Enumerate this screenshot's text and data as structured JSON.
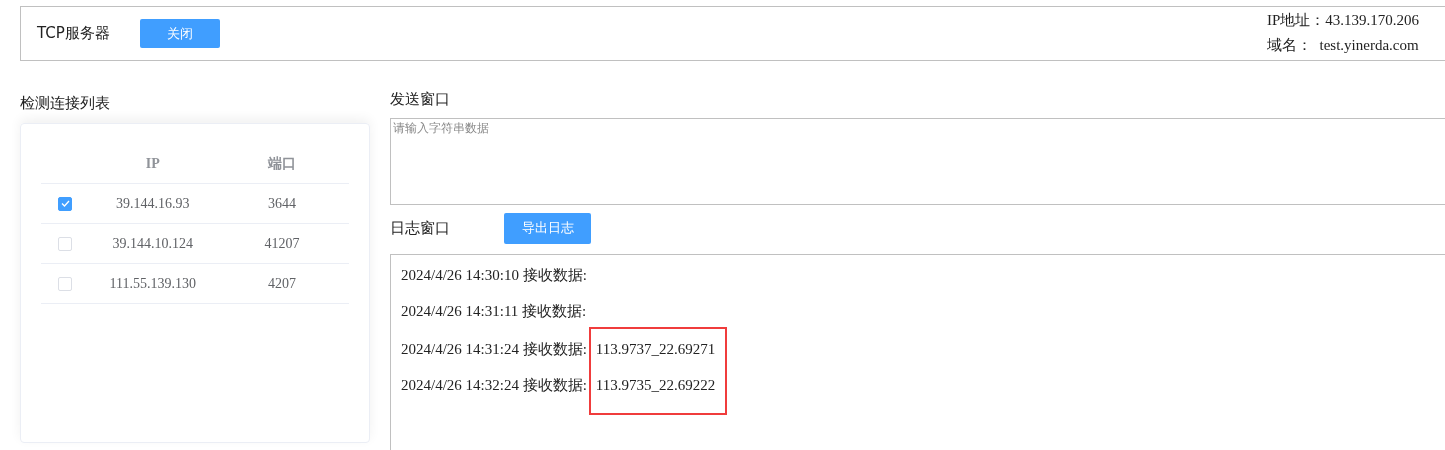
{
  "header": {
    "title": "TCP服务器",
    "button": "关闭",
    "ip_label": "IP地址：43.139.170.206",
    "domain_label": "域名：  test.yinerda.com"
  },
  "connections": {
    "title": "检测连接列表",
    "columns": [
      "IP",
      "端口"
    ],
    "rows": [
      {
        "ip": "39.144.16.93",
        "port": "3644",
        "checked": true
      },
      {
        "ip": "39.144.10.124",
        "port": "41207",
        "checked": false
      },
      {
        "ip": "111.55.139.130",
        "port": "4207",
        "checked": false
      }
    ]
  },
  "send": {
    "title": "发送窗口",
    "placeholder": "请输入字符串数据"
  },
  "log": {
    "title": "日志窗口",
    "button": "导出日志",
    "entries": [
      {
        "text": "2024/4/26 14:30:10 接收数据:",
        "highlighted": false
      },
      {
        "text": "2024/4/26 14:31:11 接收数据:",
        "highlighted": false
      },
      {
        "text": "2024/4/26 14:31:24 接收数据:",
        "value": "113.9737_22.69271",
        "highlighted": true
      },
      {
        "text": "2024/4/26 14:32:24 接收数据:",
        "value": "113.9735_22.69222",
        "highlighted": true
      }
    ]
  }
}
